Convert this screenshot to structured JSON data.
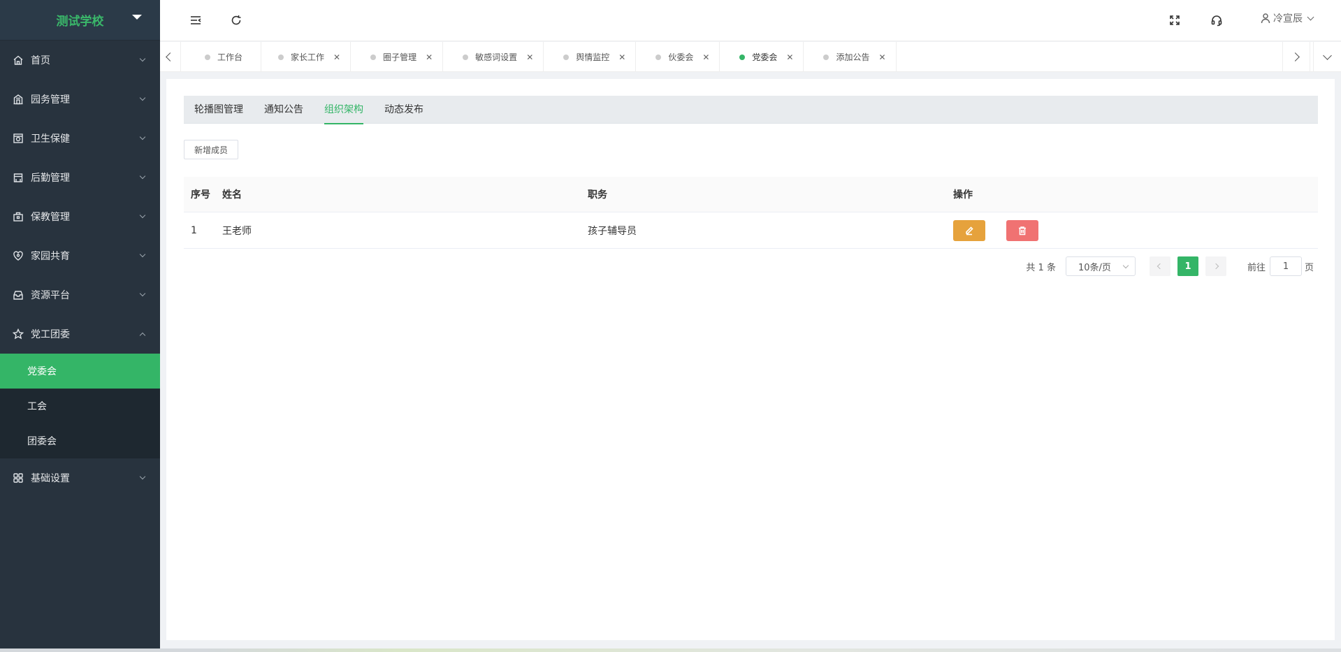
{
  "brand": {
    "title": "测试学校"
  },
  "sidebar": {
    "items": [
      {
        "label": "首页",
        "icon": "home-icon"
      },
      {
        "label": "园务管理",
        "icon": "building-icon"
      },
      {
        "label": "卫生保健",
        "icon": "health-icon"
      },
      {
        "label": "后勤管理",
        "icon": "logistics-icon"
      },
      {
        "label": "保教管理",
        "icon": "briefcase-icon"
      },
      {
        "label": "家园共育",
        "icon": "heart-icon"
      },
      {
        "label": "资源平台",
        "icon": "inbox-icon"
      },
      {
        "label": "党工团委",
        "icon": "star-icon",
        "expanded": true
      },
      {
        "label": "基础设置",
        "icon": "grid-icon"
      }
    ],
    "submenu": [
      {
        "label": "党委会",
        "active": true
      },
      {
        "label": "工会"
      },
      {
        "label": "团委会"
      }
    ]
  },
  "header": {
    "user_name": "冷宣辰"
  },
  "tags": [
    {
      "label": "工作台",
      "closable": false
    },
    {
      "label": "家长工作",
      "closable": true
    },
    {
      "label": "圈子管理",
      "closable": true
    },
    {
      "label": "敏感词设置",
      "closable": true
    },
    {
      "label": "舆情监控",
      "closable": true
    },
    {
      "label": "伙委会",
      "closable": true
    },
    {
      "label": "党委会",
      "closable": true,
      "active": true
    },
    {
      "label": "添加公告",
      "closable": true
    }
  ],
  "subtabs": [
    "轮播图管理",
    "通知公告",
    "组织架构",
    "动态发布"
  ],
  "active_subtab": "组织架构",
  "add_button": "新增成员",
  "table": {
    "columns": [
      "序号",
      "姓名",
      "职务",
      "操作"
    ],
    "rows": [
      {
        "idx": "1",
        "name": "王老师",
        "role": "孩子辅导员"
      }
    ]
  },
  "pagination": {
    "total_text": "共 1 条",
    "page_size": "10条/页",
    "current_page": "1",
    "goto_label": "前往",
    "goto_value": "1",
    "page_suffix": "页"
  },
  "colors": {
    "accent": "#34b567",
    "sidebar_bg": "#28333e",
    "edit": "#e6a23c",
    "delete": "#f07272"
  }
}
